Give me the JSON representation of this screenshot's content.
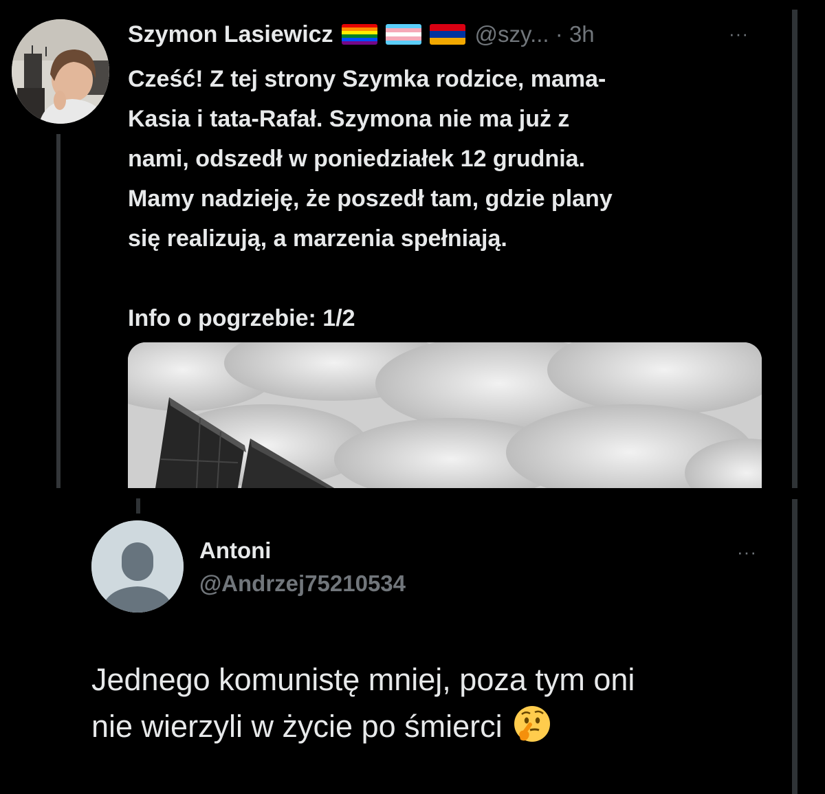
{
  "parent_tweet": {
    "author_name": "Szymon Lasiewicz",
    "flags": [
      "rainbow-pride-flag",
      "transgender-flag",
      "armenian-flag"
    ],
    "handle": "@szy...",
    "separator": "·",
    "time": "3h",
    "more_label": "···",
    "text_lines": [
      "Cześć! Z tej strony Szymka rodzice, mama-",
      "Kasia i tata-Rafał. Szymona nie ma już z",
      "nami, odszedł w poniedziałek 12 grudnia.",
      "Mamy nadzieję, że poszedł tam, gdzie plany",
      "się realizują, a marzenia spełniają."
    ],
    "info_line": "Info o pogrzebie: 1/2",
    "media_icon": "grayscale-cloudy-sky-building-photo"
  },
  "reply_tweet": {
    "author_name": "Antoni",
    "handle": "@Andrzej75210534",
    "more_label": "···",
    "avatar_icon": "default-profile-icon",
    "text_line_1": "Jednego komunistę mniej, poza tym oni",
    "text_line_2": "nie wierzyli w życie po śmierci",
    "emoji_icon": "thinking-face-icon"
  },
  "colors": {
    "background": "#000000",
    "primary_text": "#e7e9ea",
    "secondary_text": "#71767b",
    "border": "#2f3336"
  }
}
